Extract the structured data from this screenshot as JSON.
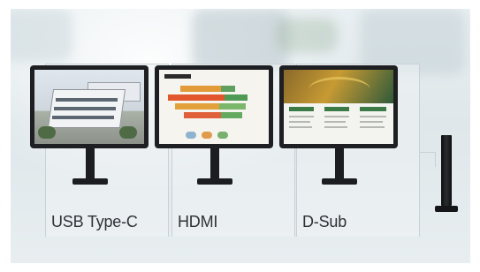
{
  "ports": [
    {
      "label": "USB Type-C",
      "screen": "building-photo"
    },
    {
      "label": "HDMI",
      "screen": "presentation-slide"
    },
    {
      "label": "D-Sub",
      "screen": "website"
    }
  ],
  "colors": {
    "bezel": "#1e1f22",
    "label": "#2e3236",
    "panel_border": "#c8d1d5"
  },
  "icons": [
    "monitor-icon",
    "tower-speaker-icon"
  ]
}
